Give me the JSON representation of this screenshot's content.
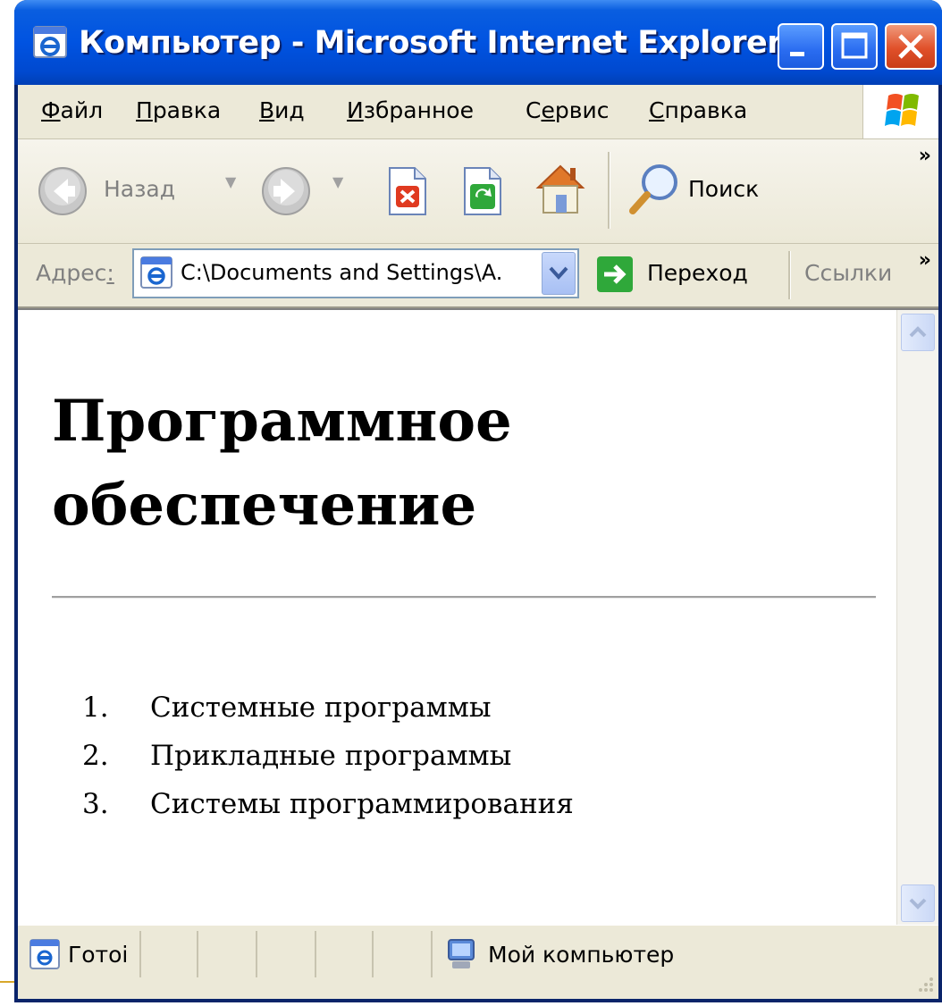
{
  "window": {
    "title": "Компьютер - Microsoft Internet Explorer"
  },
  "menu": {
    "items": [
      {
        "underline": "Ф",
        "rest": "айл"
      },
      {
        "underline": "П",
        "rest": "равка"
      },
      {
        "underline": "В",
        "rest": "ид"
      },
      {
        "underline": "И",
        "rest": "збранное"
      },
      {
        "prefix": "С",
        "underline": "е",
        "rest": "рвис"
      },
      {
        "underline": "С",
        "rest": "правка"
      }
    ]
  },
  "toolbar": {
    "back_label": "Назад",
    "search_label": "Поиск",
    "more": "»"
  },
  "address": {
    "label_prefix": "Адрес",
    "label_underline": ":",
    "value": "C:\\Documents and Settings\\A.",
    "go_label": "Переход",
    "links_label": "Ссылки",
    "more": "»"
  },
  "page": {
    "heading": "Программное обеспечение",
    "list": [
      {
        "num": "1.",
        "text": "Системные программы"
      },
      {
        "num": "2.",
        "text": "Прикладные программы"
      },
      {
        "num": "3.",
        "text": "Системы программирования"
      }
    ]
  },
  "status": {
    "text": "Готоі",
    "zone": "Мой компьютер"
  },
  "colors": {
    "titlebar": "#0053e1",
    "close_button": "#e0502a",
    "chrome": "#ece9d8",
    "go_arrow": "#2fa83a"
  }
}
